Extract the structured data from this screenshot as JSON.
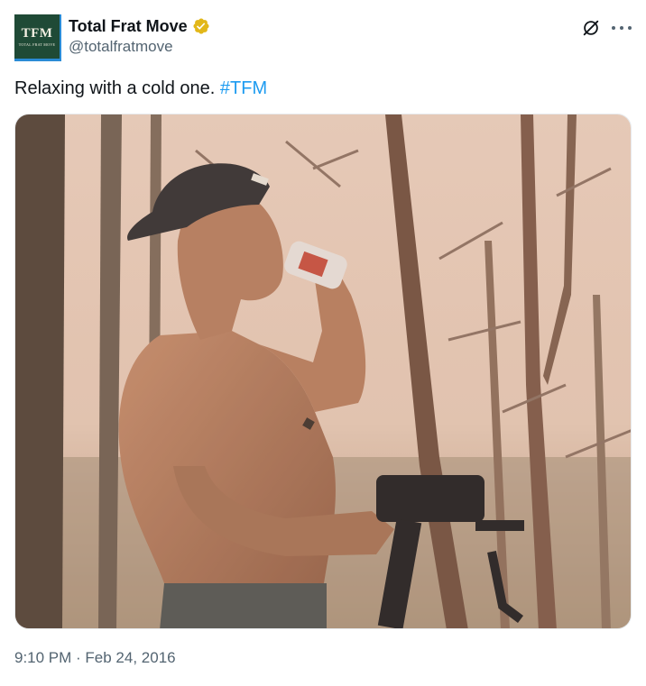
{
  "author": {
    "avatar_text": "TFM",
    "avatar_subtext": "TOTAL FRAT MOVE",
    "display_name": "Total Frat Move",
    "handle": "@totalfratmove",
    "verified": true,
    "verified_color": "#e2b719",
    "avatar_color": "#1f4a36"
  },
  "actions": {
    "grok_icon": "grok-icon",
    "more_icon": "more-options-icon"
  },
  "tweet": {
    "text": "Relaxing with a cold one. ",
    "hashtag": "#TFM",
    "hashtag_color": "#1d9bf0"
  },
  "media": {
    "icon": "photo"
  },
  "meta": {
    "timestamp": "9:10 PM · Feb 24, 2016"
  }
}
